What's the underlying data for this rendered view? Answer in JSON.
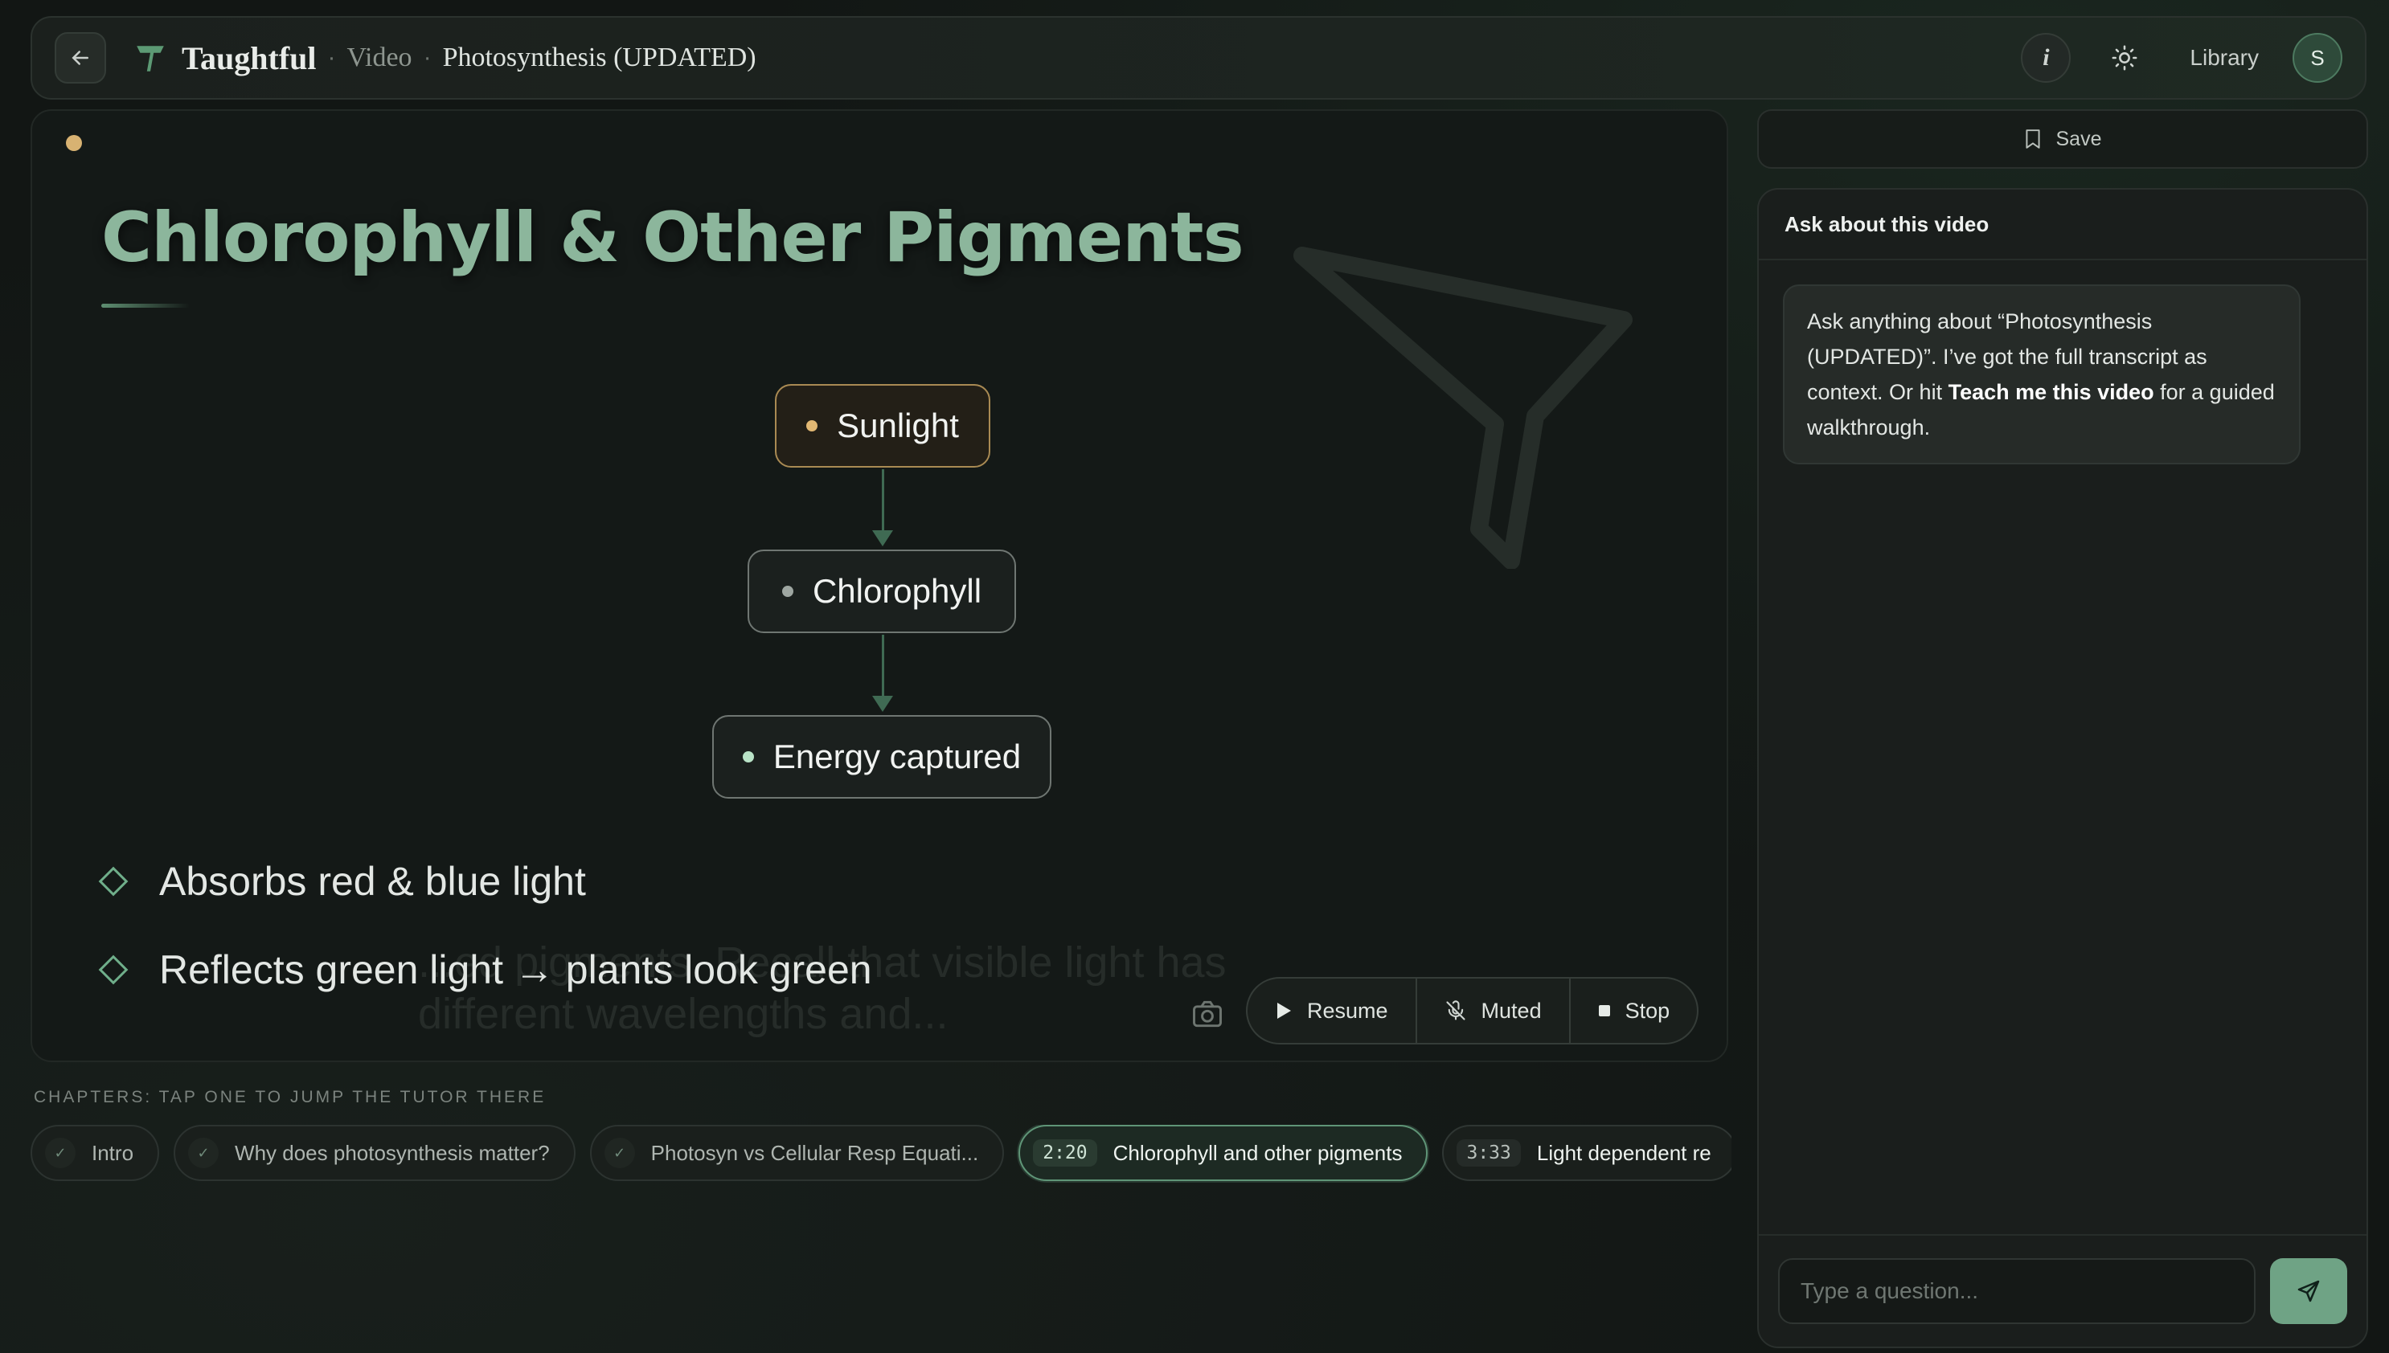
{
  "header": {
    "brand": "Taughtful",
    "breadcrumb_section": "Video",
    "breadcrumb_title": "Photosynthesis (UPDATED)",
    "info_label": "i",
    "library_label": "Library",
    "avatar_initial": "S"
  },
  "slide": {
    "title": "Chlorophyll & Other Pigments",
    "nodes": [
      "Sunlight",
      "Chlorophyll",
      "Energy captured"
    ],
    "bullets": [
      "Absorbs red & blue light",
      "Reflects green light → plants look green"
    ],
    "caption_ghost": "...ed pigments. Recall that visible light has different wavelengths and..."
  },
  "controls": {
    "resume": "Resume",
    "muted": "Muted",
    "stop": "Stop"
  },
  "chapters": {
    "label": "CHAPTERS: TAP ONE TO JUMP THE TUTOR THERE",
    "items": [
      {
        "label": "Intro",
        "status": "done"
      },
      {
        "label": "Why does photosynthesis matter?",
        "status": "done"
      },
      {
        "label": "Photosyn vs Cellular Resp Equati...",
        "status": "done"
      },
      {
        "label": "Chlorophyll and other pigments",
        "time": "2:20",
        "status": "active"
      },
      {
        "label": "Light dependent re",
        "time": "3:33",
        "status": "upcoming"
      }
    ]
  },
  "sidebar": {
    "save_label": "Save",
    "chat_title": "Ask about this video",
    "message_part1": "Ask anything about “Photosynthesis (UPDATED)”. I’ve got the full transcript as context. Or hit ",
    "message_bold": "Teach me this video",
    "message_part2": " for a guided walkthrough.",
    "input_placeholder": "Type a question..."
  },
  "colors": {
    "accent": "#6fa385",
    "sun": "#e2b873",
    "title": "#8cb69c"
  }
}
